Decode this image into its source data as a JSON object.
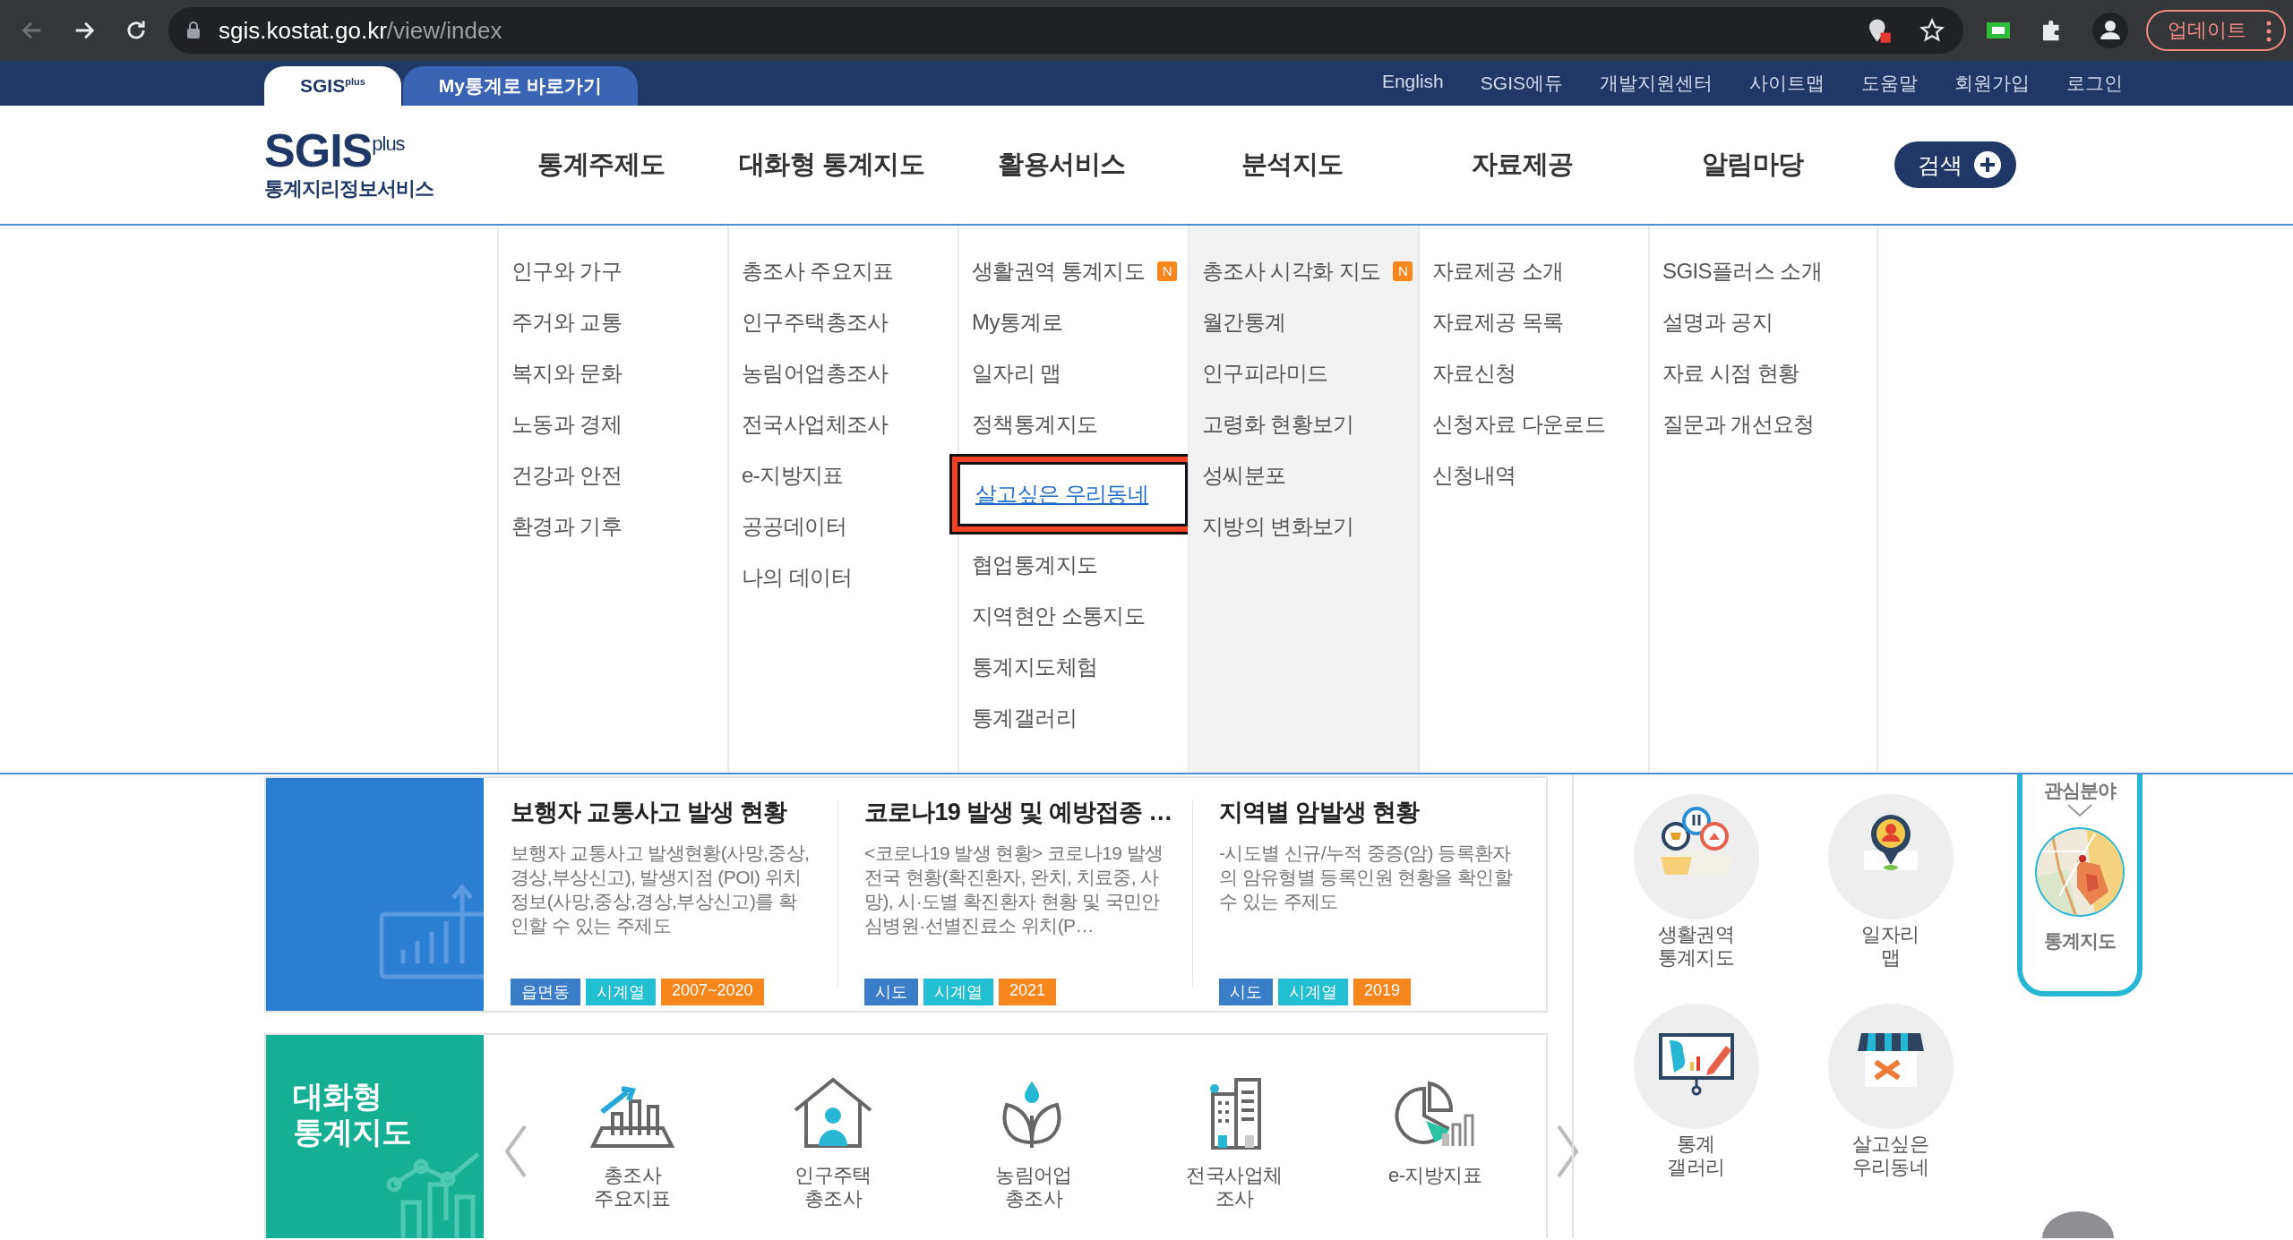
{
  "browser": {
    "url_host": "sgis.kostat.go.kr",
    "url_path": "/view/index",
    "update_button": "업데이트"
  },
  "top_bar": {
    "tabs": [
      {
        "label": "SGIS$^{plus}$",
        "selected": true
      },
      {
        "label": "My통계로 바로가기",
        "selected": false
      }
    ],
    "links": [
      "English",
      "SGIS에듀",
      "개발지원센터",
      "사이트맵",
      "도움말",
      "회원가입",
      "로그인"
    ]
  },
  "header": {
    "logo": "SGIS",
    "logo_sup": "plus",
    "logo_subtitle": "통계지리정보서비스",
    "nav": [
      "통계주제도",
      "대화형 통계지도",
      "활용서비스",
      "분석지도",
      "자료제공",
      "알림마당"
    ],
    "search_button": "검색"
  },
  "mega_menu": [
    {
      "shaded": false,
      "items": [
        {
          "label": "인구와 가구",
          "highlighted": false
        },
        {
          "label": "주거와 교통",
          "highlighted": false
        },
        {
          "label": "복지와 문화",
          "highlighted": false
        },
        {
          "label": "노동과 경제",
          "highlighted": false
        },
        {
          "label": "건강과 안전",
          "highlighted": false
        },
        {
          "label": "환경과 기후",
          "highlighted": false
        }
      ]
    },
    {
      "shaded": false,
      "items": [
        {
          "label": "총조사 주요지표",
          "highlighted": false
        },
        {
          "label": "인구주택총조사",
          "highlighted": false
        },
        {
          "label": "농림어업총조사",
          "highlighted": false
        },
        {
          "label": "전국사업체조사",
          "highlighted": false
        },
        {
          "label": "e-지방지표",
          "highlighted": false
        },
        {
          "label": "공공데이터",
          "highlighted": false
        },
        {
          "label": "나의 데이터",
          "highlighted": false
        }
      ]
    },
    {
      "shaded": false,
      "items": [
        {
          "label": "생활권역 통계지도",
          "badge": "N",
          "highlighted": false
        },
        {
          "label": "My통계로",
          "highlighted": false
        },
        {
          "label": "일자리 맵",
          "highlighted": false
        },
        {
          "label": "정책통계지도",
          "highlighted": false
        },
        {
          "label": "살고싶은 우리동네",
          "highlighted": true
        },
        {
          "label": "협업통계지도",
          "highlighted": false
        },
        {
          "label": "지역현안 소통지도",
          "highlighted": false
        },
        {
          "label": "통계지도체험",
          "highlighted": false
        },
        {
          "label": "통계갤러리",
          "highlighted": false
        }
      ]
    },
    {
      "shaded": true,
      "items": [
        {
          "label": "총조사 시각화 지도",
          "badge": "N",
          "highlighted": false
        },
        {
          "label": "월간통계",
          "highlighted": false
        },
        {
          "label": "인구피라미드",
          "highlighted": false
        },
        {
          "label": "고령화 현황보기",
          "highlighted": false
        },
        {
          "label": "성씨분포",
          "highlighted": false
        },
        {
          "label": "지방의 변화보기",
          "highlighted": false
        }
      ]
    },
    {
      "shaded": false,
      "items": [
        {
          "label": "자료제공 소개",
          "highlighted": false
        },
        {
          "label": "자료제공 목록",
          "highlighted": false
        },
        {
          "label": "자료신청",
          "highlighted": false
        },
        {
          "label": "신청자료 다운로드",
          "highlighted": false
        },
        {
          "label": "신청내역",
          "highlighted": false
        }
      ]
    },
    {
      "shaded": false,
      "items": [
        {
          "label": "SGIS플러스 소개",
          "highlighted": false
        },
        {
          "label": "설명과 공지",
          "highlighted": false
        },
        {
          "label": "자료 시점 현황",
          "highlighted": false
        },
        {
          "label": "질문과 개선요청",
          "highlighted": false
        }
      ]
    }
  ],
  "theme_cards": [
    {
      "title": "보행자 교통사고 발생 현황",
      "description": "보행자 교통사고 발생현황(사망,중상,경상,부상신고), 발생지점 (POI) 위치 정보(사망,중상,경상,부상신고)를 확인할 수 있는 주제도",
      "tags": [
        {
          "label": "읍면동",
          "color": "#3a7dc9"
        },
        {
          "label": "시계열",
          "color": "#22bed2"
        },
        {
          "label": "2007~2020",
          "color": "#f7861c"
        }
      ]
    },
    {
      "title": "코로나19 발생 및 예방접종 …",
      "description": "<코로나19 발생 현황> 코로나19 발생 전국 현황(확진환자, 완치, 치료중, 사망), 시·도별 확진환자 현황 및 국민안심병원·선별진료소 위치(P…",
      "tags": [
        {
          "label": "시도",
          "color": "#3a7dc9"
        },
        {
          "label": "시계열",
          "color": "#22bed2"
        },
        {
          "label": "2021",
          "color": "#f7861c"
        }
      ]
    },
    {
      "title": "지역별 암발생 현황",
      "description": "-시도별 신규/누적 중증(암) 등록환자의 암유형별 등록인원 현황을 확인할 수 있는 주제도",
      "tags": [
        {
          "label": "시도",
          "color": "#3a7dc9"
        },
        {
          "label": "시계열",
          "color": "#22bed2"
        },
        {
          "label": "2019",
          "color": "#f7861c"
        }
      ]
    }
  ],
  "quick_services": [
    "생활권역\n통계지도",
    "일자리\n맵",
    "통계\n갤러리",
    "살고싶은\n우리동네"
  ],
  "interest": {
    "heading": "관심분야",
    "item": "통계지도"
  },
  "interactive_map": {
    "title": "대화형\n통계지도",
    "items": [
      "총조사\n주요지표",
      "인구주택\n총조사",
      "농림어업\n총조사",
      "전국사업체\n조사",
      "e-지방지표"
    ]
  }
}
